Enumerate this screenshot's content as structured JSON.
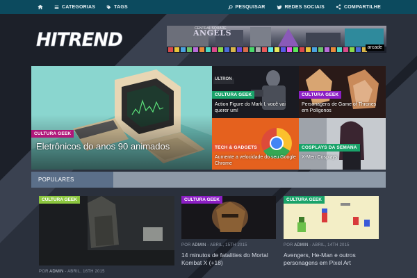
{
  "topbar": {
    "home_icon": "home-icon",
    "categories": "CATEGORIAS",
    "tags": "TAGS",
    "search": "PESQUISAR",
    "social": "REDES SOCIAIS",
    "share": "COMPARTILHE"
  },
  "logo": {
    "text": "HITREND"
  },
  "ad": {
    "title": "ANGELS",
    "subtitle": "CENTRAL SQUARE",
    "badge": "arcade"
  },
  "featured": [
    {
      "tag": "Cultura Geek",
      "caption": "Eletrônicos do anos 90 animados",
      "tag_color": "#b0167a"
    },
    {
      "tag": "Cultura Geek",
      "caption": "Action Figure do Mark I, você vai querer um!",
      "tag_color": "#1aa36a"
    },
    {
      "tag": "Cultura Geek",
      "caption": "Personagens de Game of Thrones em Polígonos",
      "tag_color": "#8c1fc4"
    },
    {
      "tag": "Tech & Gadgets",
      "caption": "Aumente a velocidade do seu Google Chrome",
      "tag_color": "#e4572e"
    },
    {
      "tag": "Cosplays da Semana",
      "caption": "X-Men Cosplays",
      "tag_color": "#1aa36a"
    }
  ],
  "popular": {
    "label": "POPULARES",
    "cards": [
      {
        "tag": "Cultura Geek",
        "meta_prefix": "POR",
        "author": "ADMIN",
        "date": "ABRIL, 16TH 2015",
        "title": "",
        "tag_color": "#8cc63f"
      },
      {
        "tag": "Cultura Geek",
        "meta_prefix": "POR",
        "author": "ADMIN",
        "date": "ABRIL, 15TH 2015",
        "title": "14 minutos de fatalities do Mortal Kombat X (+18)",
        "tag_color": "#8c1fc4"
      },
      {
        "tag": "Cultura Geek",
        "meta_prefix": "POR",
        "author": "ADMIN",
        "date": "ABRIL, 14TH 2015",
        "title": "Avengers, He-Man e outros personagens em Pixel Art",
        "tag_color": "#1aa36a"
      }
    ]
  },
  "colors": {
    "topbar": "#0c4a5e",
    "background": "#1c2029",
    "popular_bar": "#8e9aa8",
    "popular_label": "#5b6f89"
  }
}
